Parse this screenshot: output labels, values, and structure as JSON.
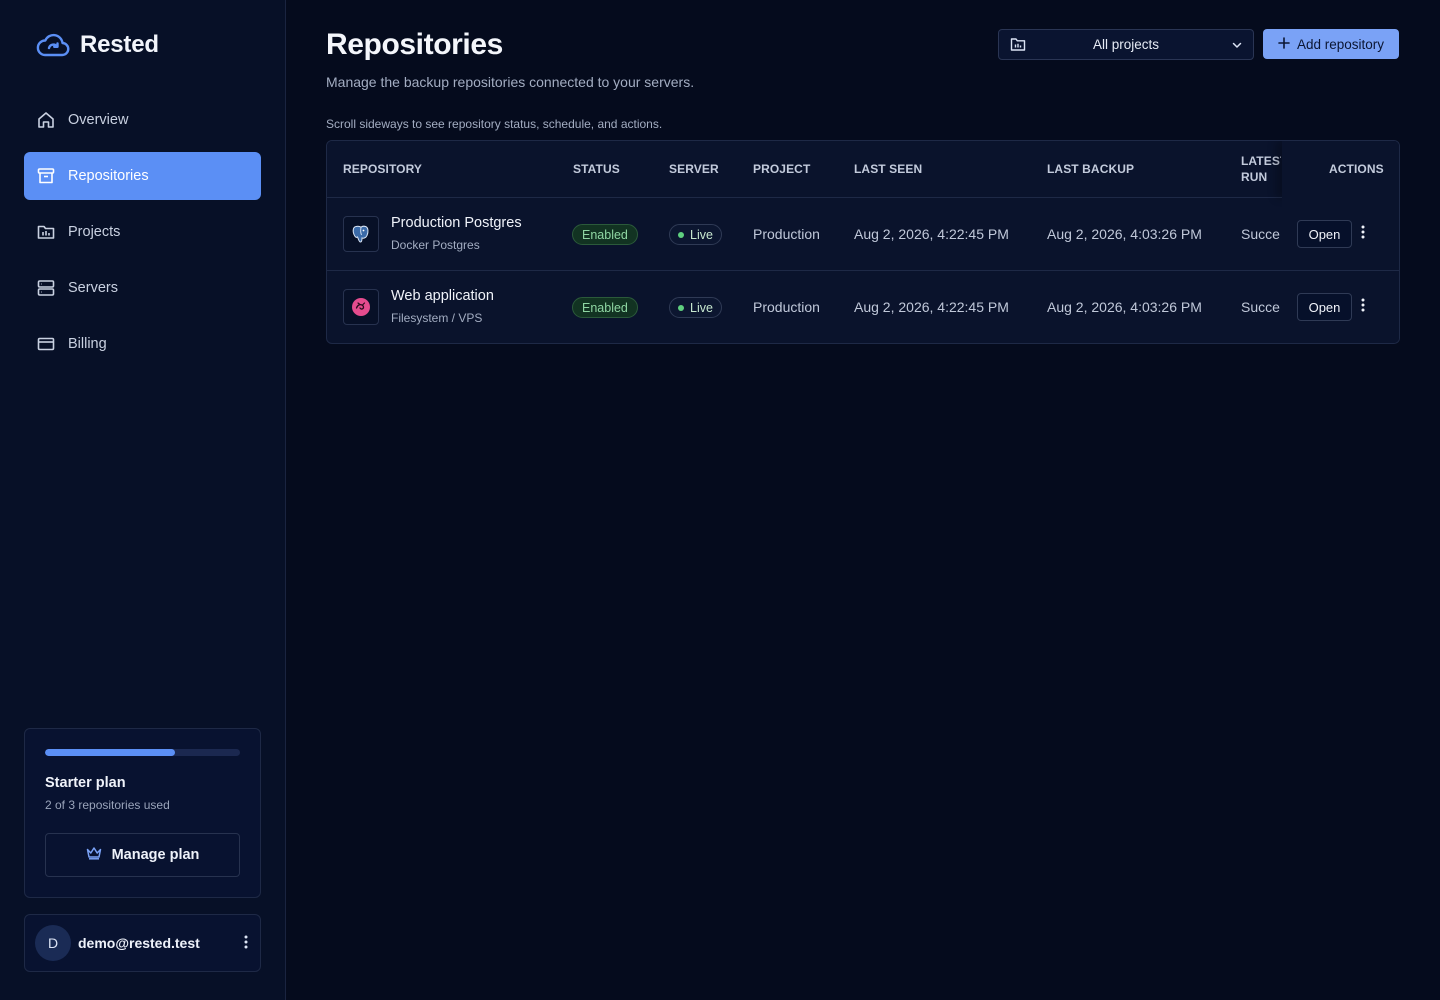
{
  "app": {
    "brand": "Rested"
  },
  "sidebar": {
    "items": [
      {
        "label": "Overview",
        "icon": "home-icon",
        "active": false
      },
      {
        "label": "Repositories",
        "icon": "archive-icon",
        "active": true
      },
      {
        "label": "Projects",
        "icon": "folder-icon",
        "active": false
      },
      {
        "label": "Servers",
        "icon": "server-icon",
        "active": false
      },
      {
        "label": "Billing",
        "icon": "credit-card-icon",
        "active": false
      }
    ],
    "plan": {
      "name": "Starter plan",
      "usage": "2 of 3 repositories used",
      "used_fraction": 0.667,
      "manage_label": "Manage plan"
    },
    "user": {
      "initial": "D",
      "email": "demo@rested.test"
    }
  },
  "main": {
    "title": "Repositories",
    "subtitle": "Manage the backup repositories connected to your servers.",
    "project_filter": "All projects",
    "add_label": "Add repository",
    "hint": "Scroll sideways to see repository status, schedule, and actions.",
    "table": {
      "columns": [
        "Repository",
        "Status",
        "Server",
        "Project",
        "Last seen",
        "Last backup",
        "Latest run",
        "Actions"
      ],
      "rows": [
        {
          "name": "Production Postgres",
          "type": "Docker Postgres",
          "icon": "postgres-icon",
          "status": "Enabled",
          "server": "Live",
          "project": "Production",
          "last_seen": "Aug 2, 2026, 4:22:45 PM",
          "last_backup": "Aug 2, 2026, 4:03:26 PM",
          "latest_run": "Succe",
          "open_label": "Open"
        },
        {
          "name": "Web application",
          "type": "Filesystem / VPS",
          "icon": "app-icon",
          "status": "Enabled",
          "server": "Live",
          "project": "Production",
          "last_seen": "Aug 2, 2026, 4:22:45 PM",
          "last_backup": "Aug 2, 2026, 4:03:26 PM",
          "latest_run": "Succe",
          "open_label": "Open"
        }
      ]
    }
  },
  "colors": {
    "accent": "#5b8ff5",
    "background": "#050b1d",
    "success": "#5fd07f"
  }
}
